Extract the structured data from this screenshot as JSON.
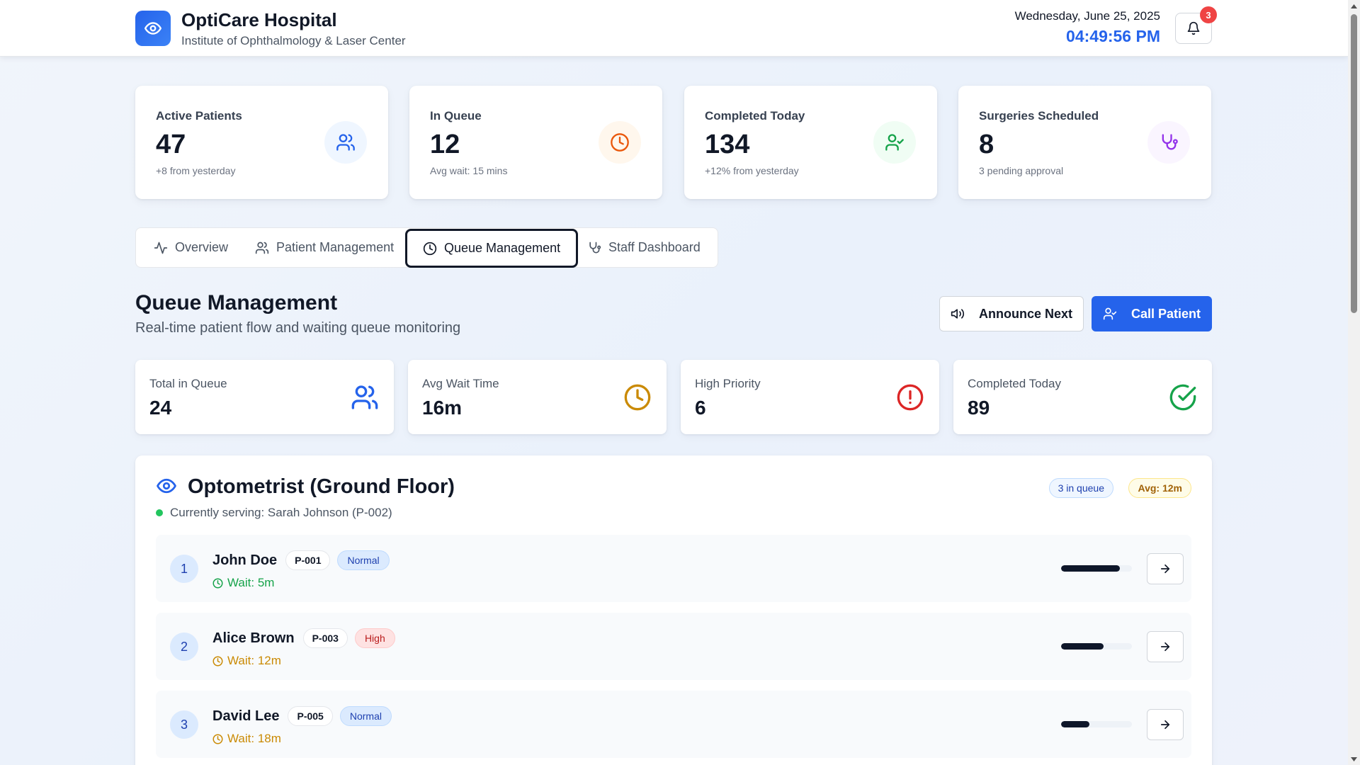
{
  "header": {
    "brand_title": "OptiCare Hospital",
    "brand_subtitle": "Institute of Ophthalmology & Laser Center",
    "date": "Wednesday, June 25, 2025",
    "time": "04:49:56 PM",
    "notification_count": "3"
  },
  "stats": [
    {
      "label": "Active Patients",
      "value": "47",
      "sub": "+8 from yesterday",
      "icon": "users-icon",
      "color": "#2563eb"
    },
    {
      "label": "In Queue",
      "value": "12",
      "sub": "Avg wait: 15 mins",
      "icon": "clock-icon",
      "color": "#ea580c"
    },
    {
      "label": "Completed Today",
      "value": "134",
      "sub": "+12% from yesterday",
      "icon": "user-check-icon",
      "color": "#16a34a"
    },
    {
      "label": "Surgeries Scheduled",
      "value": "8",
      "sub": "3 pending approval",
      "icon": "stethoscope-icon",
      "color": "#9333ea"
    }
  ],
  "tabs": [
    {
      "label": "Overview",
      "icon": "activity-icon",
      "active": false
    },
    {
      "label": "Patient Management",
      "icon": "users-icon",
      "active": false
    },
    {
      "label": "Queue Management",
      "icon": "clock-icon",
      "active": true
    },
    {
      "label": "Staff Dashboard",
      "icon": "stethoscope-icon",
      "active": false
    }
  ],
  "section": {
    "title": "Queue Management",
    "subtitle": "Real-time patient flow and waiting queue monitoring",
    "announce_label": "Announce Next",
    "call_label": "Call Patient"
  },
  "mini_stats": [
    {
      "label": "Total in Queue",
      "value": "24",
      "icon": "users-icon",
      "color": "#2563eb"
    },
    {
      "label": "Avg Wait Time",
      "value": "16m",
      "icon": "clock-icon",
      "color": "#ca8a04"
    },
    {
      "label": "High Priority",
      "value": "6",
      "icon": "alert-circle-icon",
      "color": "#dc2626"
    },
    {
      "label": "Completed Today",
      "value": "89",
      "icon": "check-circle-icon",
      "color": "#16a34a"
    }
  ],
  "queue": {
    "title": "Optometrist (Ground Floor)",
    "serving": "Currently serving: Sarah Johnson (P-002)",
    "count_badge": "3 in queue",
    "avg_badge": "Avg: 12m",
    "rows": [
      {
        "num": "1",
        "name": "John Doe",
        "id": "P-001",
        "priority": "Normal",
        "wait": "Wait: 5m",
        "progress": 0.83
      },
      {
        "num": "2",
        "name": "Alice Brown",
        "id": "P-003",
        "priority": "High",
        "wait": "Wait: 12m",
        "progress": 0.6
      },
      {
        "num": "3",
        "name": "David Lee",
        "id": "P-005",
        "priority": "Normal",
        "wait": "Wait: 18m",
        "progress": 0.4
      }
    ]
  },
  "colors": {
    "primary": "#2563eb",
    "success": "#16a34a",
    "warning": "#ca8a04",
    "danger": "#dc2626"
  }
}
